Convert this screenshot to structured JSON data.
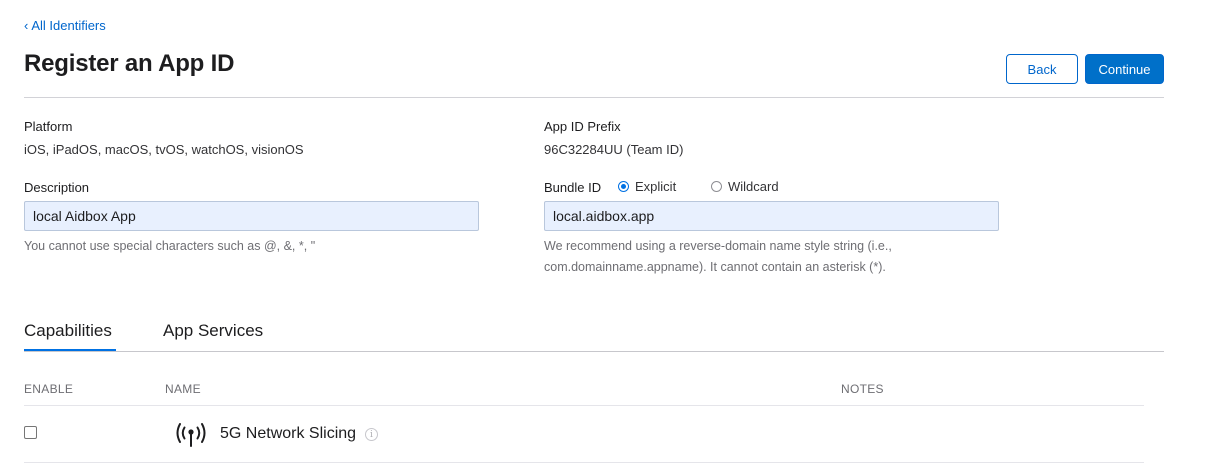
{
  "breadcrumb": {
    "chevron": "‹",
    "label": "All Identifiers"
  },
  "page": {
    "title": "Register an App ID"
  },
  "actions": {
    "back_label": "Back",
    "continue_label": "Continue"
  },
  "platform": {
    "label": "Platform",
    "value": "iOS, iPadOS, macOS, tvOS, watchOS, visionOS"
  },
  "prefix": {
    "label": "App ID Prefix",
    "value": "96C32284UU (Team ID)"
  },
  "description": {
    "label": "Description",
    "value": "local Aidbox App",
    "hint": "You cannot use special characters such as @, &, *, \""
  },
  "bundle": {
    "label": "Bundle ID",
    "options": [
      {
        "label": "Explicit",
        "selected": true
      },
      {
        "label": "Wildcard",
        "selected": false
      }
    ],
    "value": "local.aidbox.app",
    "hint": "We recommend using a reverse-domain name style string (i.e., com.domainname.appname). It cannot contain an asterisk (*)."
  },
  "tabs": [
    {
      "label": "Capabilities",
      "active": true
    },
    {
      "label": "App Services",
      "active": false
    }
  ],
  "table": {
    "columns": [
      "ENABLE",
      "NAME",
      "NOTES"
    ],
    "rows": [
      {
        "enabled": false,
        "icon": "antenna-icon",
        "name": "5G Network Slicing",
        "notes": ""
      }
    ]
  },
  "colors": {
    "accent": "#0071e3",
    "link": "#0066cc",
    "input_bg": "#e8f0fe"
  }
}
